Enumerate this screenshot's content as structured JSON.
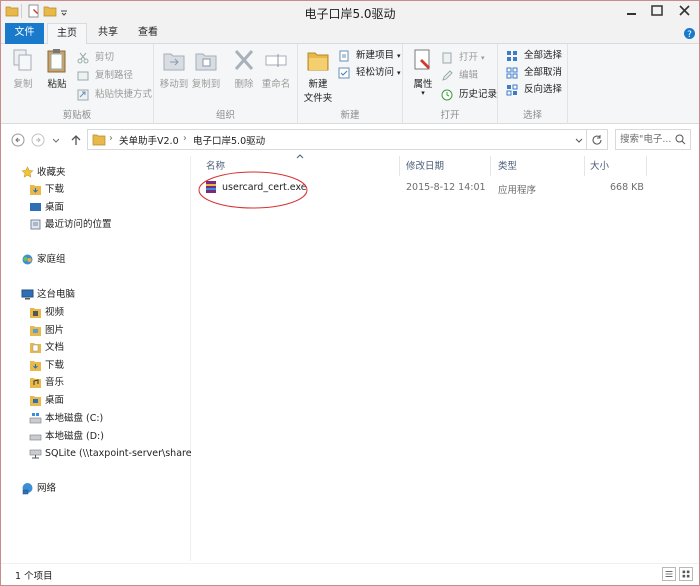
{
  "window": {
    "title": "电子口岸5.0驱动",
    "accent": "#1979ca",
    "folder_color": "#e8b84a"
  },
  "ribbon_tabs": {
    "file": "文件",
    "home": "主页",
    "share": "共享",
    "view": "查看"
  },
  "ribbon": {
    "clipboard": {
      "label": "剪贴板",
      "copy": "复制",
      "paste": "粘贴",
      "cut": "剪切",
      "copy_path": "复制路径",
      "paste_shortcut": "粘贴快捷方式"
    },
    "organize": {
      "label": "组织",
      "move_to": "移动到",
      "copy_to": "复制到",
      "delete": "删除",
      "rename": "重命名"
    },
    "new": {
      "label": "新建",
      "new_folder_line1": "新建",
      "new_folder_line2": "文件夹",
      "new_item": "新建项目",
      "easy_access": "轻松访问"
    },
    "open": {
      "label": "打开",
      "properties": "属性",
      "open": "打开",
      "edit": "编辑",
      "history": "历史记录"
    },
    "select": {
      "label": "选择",
      "select_all": "全部选择",
      "select_none": "全部取消",
      "invert": "反向选择"
    }
  },
  "address": {
    "crumbs": [
      "关单助手V2.0",
      "电子口岸5.0驱动"
    ],
    "search_placeholder": "搜索\"电子..."
  },
  "nav": {
    "favorites": "收藏夹",
    "fav_items": [
      "下载",
      "桌面",
      "最近访问的位置"
    ],
    "homegroup": "家庭组",
    "this_pc": "这台电脑",
    "pc_items": [
      "视频",
      "图片",
      "文档",
      "下载",
      "音乐",
      "桌面"
    ],
    "drives": [
      "本地磁盘 (C:)",
      "本地磁盘 (D:)",
      "SQLite (\\\\taxpoint-server\\share) ("
    ],
    "network": "网络"
  },
  "columns": {
    "name": "名称",
    "date": "修改日期",
    "type": "类型",
    "size": "大小"
  },
  "files": [
    {
      "name": "usercard_cert.exe",
      "date": "2015-8-12 14:01",
      "type": "应用程序",
      "size": "668 KB"
    }
  ],
  "status": {
    "count": "1 个项目"
  }
}
